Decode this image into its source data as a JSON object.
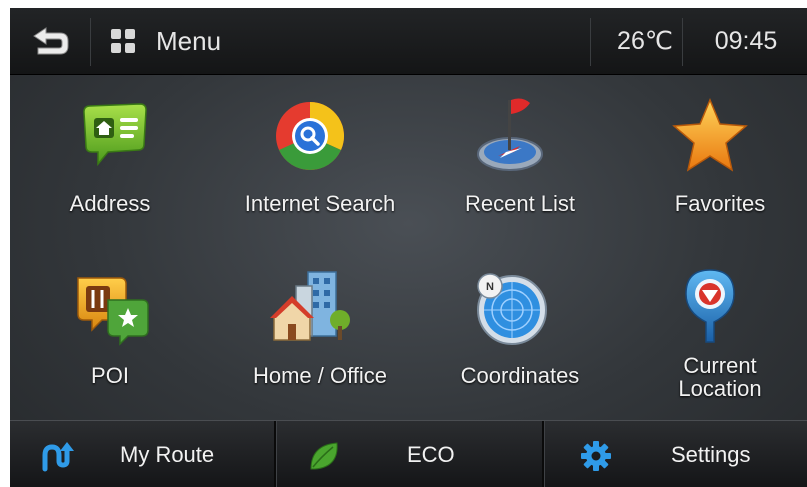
{
  "topbar": {
    "back_icon": "back-arrow-icon",
    "menu_icon": "grid-icon",
    "menu_label": "Menu",
    "temperature": "26℃",
    "time": "09:45"
  },
  "grid": {
    "items": [
      {
        "label": "Address",
        "icon": "address-icon"
      },
      {
        "label": "Internet Search",
        "icon": "internet-search-icon"
      },
      {
        "label": "Recent List",
        "icon": "recent-list-icon"
      },
      {
        "label": "Favorites",
        "icon": "favorites-star-icon"
      },
      {
        "label": "POI",
        "icon": "poi-icon"
      },
      {
        "label": "Home / Office",
        "icon": "home-office-icon"
      },
      {
        "label": "Coordinates",
        "icon": "coordinates-icon"
      },
      {
        "label_line1": "Current",
        "label_line2": "Location",
        "icon": "current-location-icon"
      }
    ]
  },
  "bottombar": {
    "my_route_label": "My Route",
    "eco_label": "ECO",
    "settings_label": "Settings"
  },
  "colors": {
    "accent_blue": "#2f9be8",
    "eco_green": "#4aa52e",
    "star_orange": "#f39a1a",
    "pin_red": "#d9342b"
  }
}
